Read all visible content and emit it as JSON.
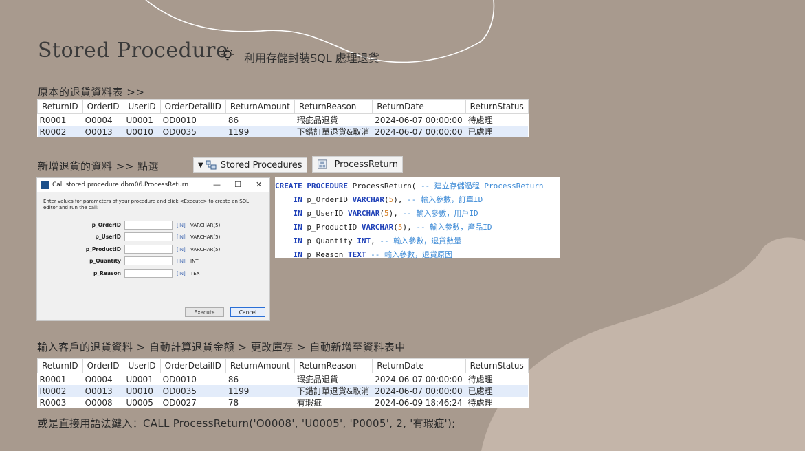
{
  "slide": {
    "title": "Stored Procedure",
    "subtitle": "利用存儲封裝SQL  處理退貨",
    "section1_label": "原本的退貨資料表  >>",
    "section2_label_prefix": "新增退貨的資料  >>  點選",
    "section3_label": "輸入客戶的退貨資料  > 自動計算退貨金額 > 更改庫存 > 自動新增至資料表中",
    "final_line": "或是直接用語法鍵入：CALL ProcessReturn('O0008', 'U0005', 'P0005', 2, '有瑕疵');"
  },
  "toolbar": {
    "stored_procedures_label": "Stored Procedures",
    "stored_procedures_icon": "folder-tree-icon",
    "process_return_label": "ProcessReturn",
    "process_return_icon": "procedure-icon"
  },
  "table_columns": [
    "ReturnID",
    "OrderID",
    "UserID",
    "OrderDetailID",
    "ReturnAmount",
    "ReturnReason",
    "ReturnDate",
    "ReturnStatus"
  ],
  "table_before": [
    [
      "R0001",
      "O0004",
      "U0001",
      "OD0010",
      "86",
      "瑕疵品退貨",
      "2024-06-07 00:00:00",
      "待處理"
    ],
    [
      "R0002",
      "O0013",
      "U0010",
      "OD0035",
      "1199",
      "下錯訂單退貨&取消",
      "2024-06-07 00:00:00",
      "已處理"
    ]
  ],
  "table_after": [
    [
      "R0001",
      "O0004",
      "U0001",
      "OD0010",
      "86",
      "瑕疵品退貨",
      "2024-06-07 00:00:00",
      "待處理"
    ],
    [
      "R0002",
      "O0013",
      "U0010",
      "OD0035",
      "1199",
      "下錯訂單退貨&取消",
      "2024-06-07 00:00:00",
      "已處理"
    ],
    [
      "R0003",
      "O0008",
      "U0005",
      "OD0027",
      "78",
      "有瑕疵",
      "2024-06-09 18:46:24",
      "待處理"
    ]
  ],
  "dialog": {
    "title": "Call stored procedure dbm06.ProcessReturn",
    "message": "Enter values for parameters of your procedure and click <Execute> to create an SQL editor and run the call:",
    "minimize": "—",
    "maximize": "☐",
    "close": "✕",
    "params": [
      {
        "name": "p_OrderID",
        "value": "",
        "mode": "[IN]",
        "type": "VARCHAR(5)"
      },
      {
        "name": "p_UserID",
        "value": "",
        "mode": "[IN]",
        "type": "VARCHAR(5)"
      },
      {
        "name": "p_ProductID",
        "value": "",
        "mode": "[IN]",
        "type": "VARCHAR(5)"
      },
      {
        "name": "p_Quantity",
        "value": "",
        "mode": "[IN]",
        "type": "INT"
      },
      {
        "name": "p_Reason",
        "value": "",
        "mode": "[IN]",
        "type": "TEXT"
      }
    ],
    "execute_label": "Execute",
    "cancel_label": "Cancel"
  },
  "code_lines": [
    [
      [
        "kw",
        "CREATE PROCEDURE "
      ],
      [
        "tx",
        "ProcessReturn( "
      ],
      [
        "cm",
        "-- 建立存儲過程 ProcessReturn"
      ]
    ],
    [
      [
        "tx",
        "    "
      ],
      [
        "kw",
        "IN "
      ],
      [
        "tx",
        "p_OrderID "
      ],
      [
        "kw",
        "VARCHAR"
      ],
      [
        "tx",
        "("
      ],
      [
        "nm",
        "5"
      ],
      [
        "tx",
        "), "
      ],
      [
        "cm",
        "-- 輸入參數，訂單ID"
      ]
    ],
    [
      [
        "tx",
        "    "
      ],
      [
        "kw",
        "IN "
      ],
      [
        "tx",
        "p_UserID "
      ],
      [
        "kw",
        "VARCHAR"
      ],
      [
        "tx",
        "("
      ],
      [
        "nm",
        "5"
      ],
      [
        "tx",
        "), "
      ],
      [
        "cm",
        "-- 輸入參數，用戶ID"
      ]
    ],
    [
      [
        "tx",
        "    "
      ],
      [
        "kw",
        "IN "
      ],
      [
        "tx",
        "p_ProductID "
      ],
      [
        "kw",
        "VARCHAR"
      ],
      [
        "tx",
        "("
      ],
      [
        "nm",
        "5"
      ],
      [
        "tx",
        "), "
      ],
      [
        "cm",
        "-- 輸入參數，產品ID"
      ]
    ],
    [
      [
        "tx",
        "    "
      ],
      [
        "kw",
        "IN "
      ],
      [
        "tx",
        "p_Quantity "
      ],
      [
        "kw",
        "INT"
      ],
      [
        "tx",
        ", "
      ],
      [
        "cm",
        "-- 輸入參數，退貨數量"
      ]
    ],
    [
      [
        "tx",
        "    "
      ],
      [
        "kw",
        "IN "
      ],
      [
        "tx",
        "p_Reason "
      ],
      [
        "kw",
        "TEXT "
      ],
      [
        "cm",
        "-- 輸入參數，退貨原因"
      ]
    ]
  ]
}
